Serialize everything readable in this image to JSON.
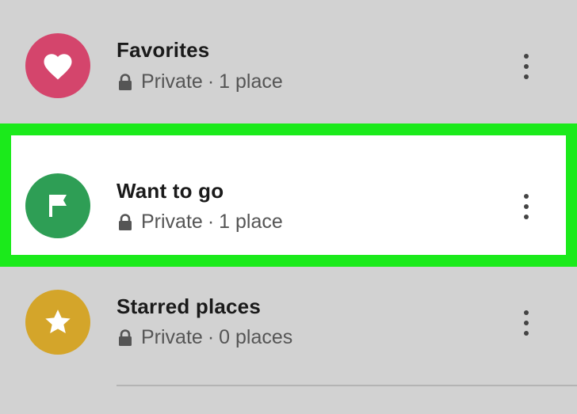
{
  "lists": [
    {
      "title": "Favorites",
      "privacy": "Private",
      "separator": "·",
      "count": "1 place",
      "icon": "heart-icon",
      "color": "#d4456c"
    },
    {
      "title": "Want to go",
      "privacy": "Private",
      "separator": "·",
      "count": "1 place",
      "icon": "flag-icon",
      "color": "#2e9e55",
      "highlighted": true,
      "highlight_color": "#1bea1b"
    },
    {
      "title": "Starred places",
      "privacy": "Private",
      "separator": "·",
      "count": "0 places",
      "icon": "star-icon",
      "color": "#d4a52a"
    }
  ],
  "more_menu_icon": "more-vert-icon",
  "privacy_icon": "lock-icon",
  "background_color": "#d2d2d2"
}
